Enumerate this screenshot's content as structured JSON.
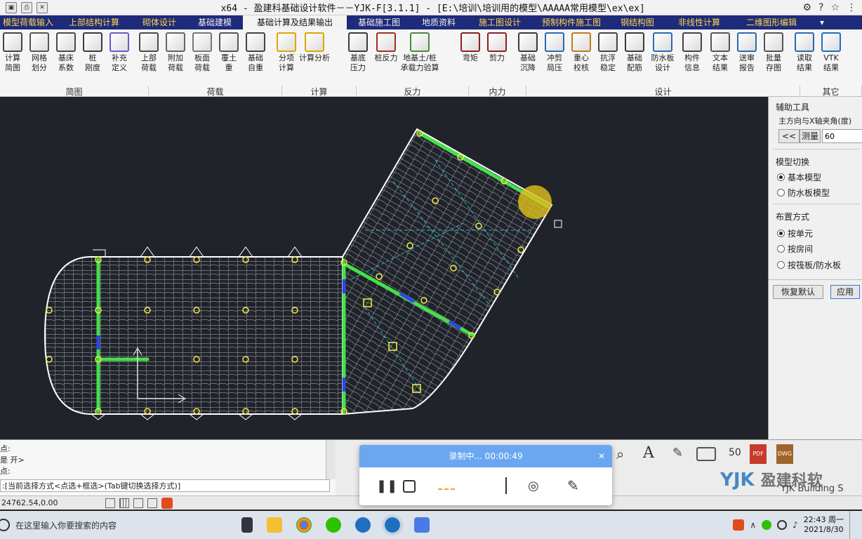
{
  "window": {
    "title": "x64 - 盈建科基础设计软件－－YJK-F[3.1.1] - [E:\\培训\\培训用的模型\\AAAAA常用模型\\ex\\ex]"
  },
  "tabs": [
    {
      "label": "模型荷载输入",
      "state": "hl"
    },
    {
      "label": "上部结构计算",
      "state": "hl"
    },
    {
      "label": "砌体设计",
      "state": "hl"
    },
    {
      "label": "基础建模",
      "state": "normal"
    },
    {
      "label": "基础计算及结果输出",
      "state": "active"
    },
    {
      "label": "基础施工图",
      "state": "normal"
    },
    {
      "label": "地质资料",
      "state": "normal"
    },
    {
      "label": "施工图设计",
      "state": "hl"
    },
    {
      "label": "预制构件施工图",
      "state": "hl"
    },
    {
      "label": "钢结构图",
      "state": "hl"
    },
    {
      "label": "非线性计算",
      "state": "hl"
    },
    {
      "label": "二维图形编辑",
      "state": "hl"
    }
  ],
  "ribbon": {
    "buttons": [
      {
        "label": "计算\n简图",
        "icon": "grid-hash-icon"
      },
      {
        "label": "网格\n划分",
        "icon": "mesh-icon"
      },
      {
        "label": "基床\n系数",
        "icon": "bed-coefficient-icon"
      },
      {
        "label": "桩\n刚度",
        "icon": "pile-stiffness-icon"
      },
      {
        "label": "补充\n定义",
        "icon": "supplement-define-icon"
      },
      {
        "label": "上部\n荷载",
        "icon": "upper-load-icon"
      },
      {
        "label": "附加\n荷载",
        "icon": "additional-load-icon"
      },
      {
        "label": "板面\n荷载",
        "icon": "slab-load-icon"
      },
      {
        "label": "覆土\n重",
        "icon": "soil-cover-icon"
      },
      {
        "label": "基础\n自重",
        "icon": "foundation-weight-icon"
      },
      {
        "label": "分项\n计算",
        "icon": "warning-calc-icon"
      },
      {
        "label": "计算分析",
        "icon": "run-analysis-icon"
      },
      {
        "label": "基底\n压力",
        "icon": "base-pressure-icon"
      },
      {
        "label": "桩反力",
        "icon": "pile-reaction-icon"
      },
      {
        "label": "地基土/桩\n承载力验算",
        "icon": "bearing-check-icon"
      },
      {
        "label": "弯矩",
        "icon": "moment-icon"
      },
      {
        "label": "剪力",
        "icon": "shear-icon"
      },
      {
        "label": "基础\n沉降",
        "icon": "settlement-icon"
      },
      {
        "label": "冲剪\n局压",
        "icon": "punching-icon"
      },
      {
        "label": "重心\n校核",
        "icon": "centroid-icon"
      },
      {
        "label": "抗浮\n稳定",
        "icon": "anti-float-icon"
      },
      {
        "label": "基础\n配筋",
        "icon": "reinforcement-icon"
      },
      {
        "label": "防水板\n设计",
        "icon": "waterproof-slab-icon"
      },
      {
        "label": "构件\n信息",
        "icon": "member-info-icon"
      },
      {
        "label": "文本\n结果",
        "icon": "text-result-icon"
      },
      {
        "label": "送审\n报告",
        "icon": "report-icon"
      },
      {
        "label": "批量\n存图",
        "icon": "batch-save-icon"
      },
      {
        "label": "读取\n结果",
        "icon": "load-result-icon"
      },
      {
        "label": "VTK\n结果",
        "icon": "vtk-icon"
      }
    ],
    "groups": [
      "简图",
      "荷载",
      "计算",
      "反力",
      "内力",
      "设计",
      "其它"
    ]
  },
  "right_panel": {
    "section_tools": "辅助工具",
    "angle_label": "主方向与X轴夹角(度)",
    "back_button": "<<",
    "measure_button": "测量",
    "angle_value": "60",
    "section_model": "模型切换",
    "model_options": [
      {
        "label": "基本模型",
        "selected": true
      },
      {
        "label": "防水板模型",
        "selected": false
      }
    ],
    "section_layout": "布置方式",
    "layout_options": [
      {
        "label": "按单元",
        "selected": true
      },
      {
        "label": "按房间",
        "selected": false
      },
      {
        "label": "按筏板/防水板",
        "selected": false
      }
    ],
    "restore_button": "恢复默认",
    "apply_button": "应用"
  },
  "command": {
    "lines": [
      "点:",
      "是 开>",
      "点:",
      ":[当前选择方式<点选+框选>(Tab键切换选择方式)]"
    ]
  },
  "status": {
    "coords": "24762.54,0.00"
  },
  "recorder": {
    "status": "录制中... 00:00:49"
  },
  "watermark": {
    "brand": "盈建科软",
    "sub": "YJK Building S"
  },
  "taskbar": {
    "search_placeholder": "在这里输入你要搜索的内容",
    "time": "22:43 周一",
    "date": "2021/8/30"
  }
}
